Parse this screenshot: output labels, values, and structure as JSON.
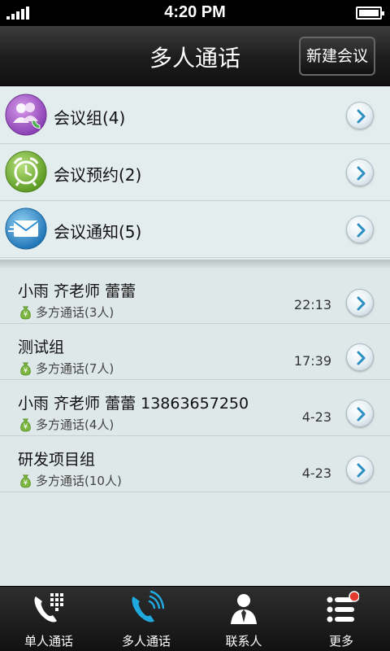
{
  "status_bar": {
    "time": "4:20 PM"
  },
  "header": {
    "title": "多人通话",
    "new_conference_label": "新建会议"
  },
  "categories": [
    {
      "label": "会议组(4)",
      "icon": "conference-group-icon",
      "color": "#9b5fc0"
    },
    {
      "label": "会议预约(2)",
      "icon": "alarm-clock-icon",
      "color": "#7cb640"
    },
    {
      "label": "会议通知(5)",
      "icon": "envelope-icon",
      "color": "#2e8fd0"
    }
  ],
  "recent_calls": [
    {
      "name": "小雨 齐老师 蕾蕾",
      "type": "多方通话(3人)",
      "time": "22:13"
    },
    {
      "name": "测试组",
      "type": "多方通话(7人)",
      "time": "17:39"
    },
    {
      "name": "小雨 齐老师 蕾蕾 13863657250",
      "type": "多方通话(4人)",
      "time": "4-23"
    },
    {
      "name": "研发项目组",
      "type": "多方通话(10人)",
      "time": "4-23"
    }
  ],
  "tabs": [
    {
      "label": "单人通话",
      "icon": "phone-keypad-icon"
    },
    {
      "label": "多人通话",
      "icon": "phone-ringing-icon",
      "active": true
    },
    {
      "label": "联系人",
      "icon": "contact-person-icon"
    },
    {
      "label": "更多",
      "icon": "more-list-icon",
      "badge": true
    }
  ],
  "colors": {
    "active_tab": "#1fa9df",
    "badge": "#e23a2e",
    "accent_green": "#7cb640"
  }
}
